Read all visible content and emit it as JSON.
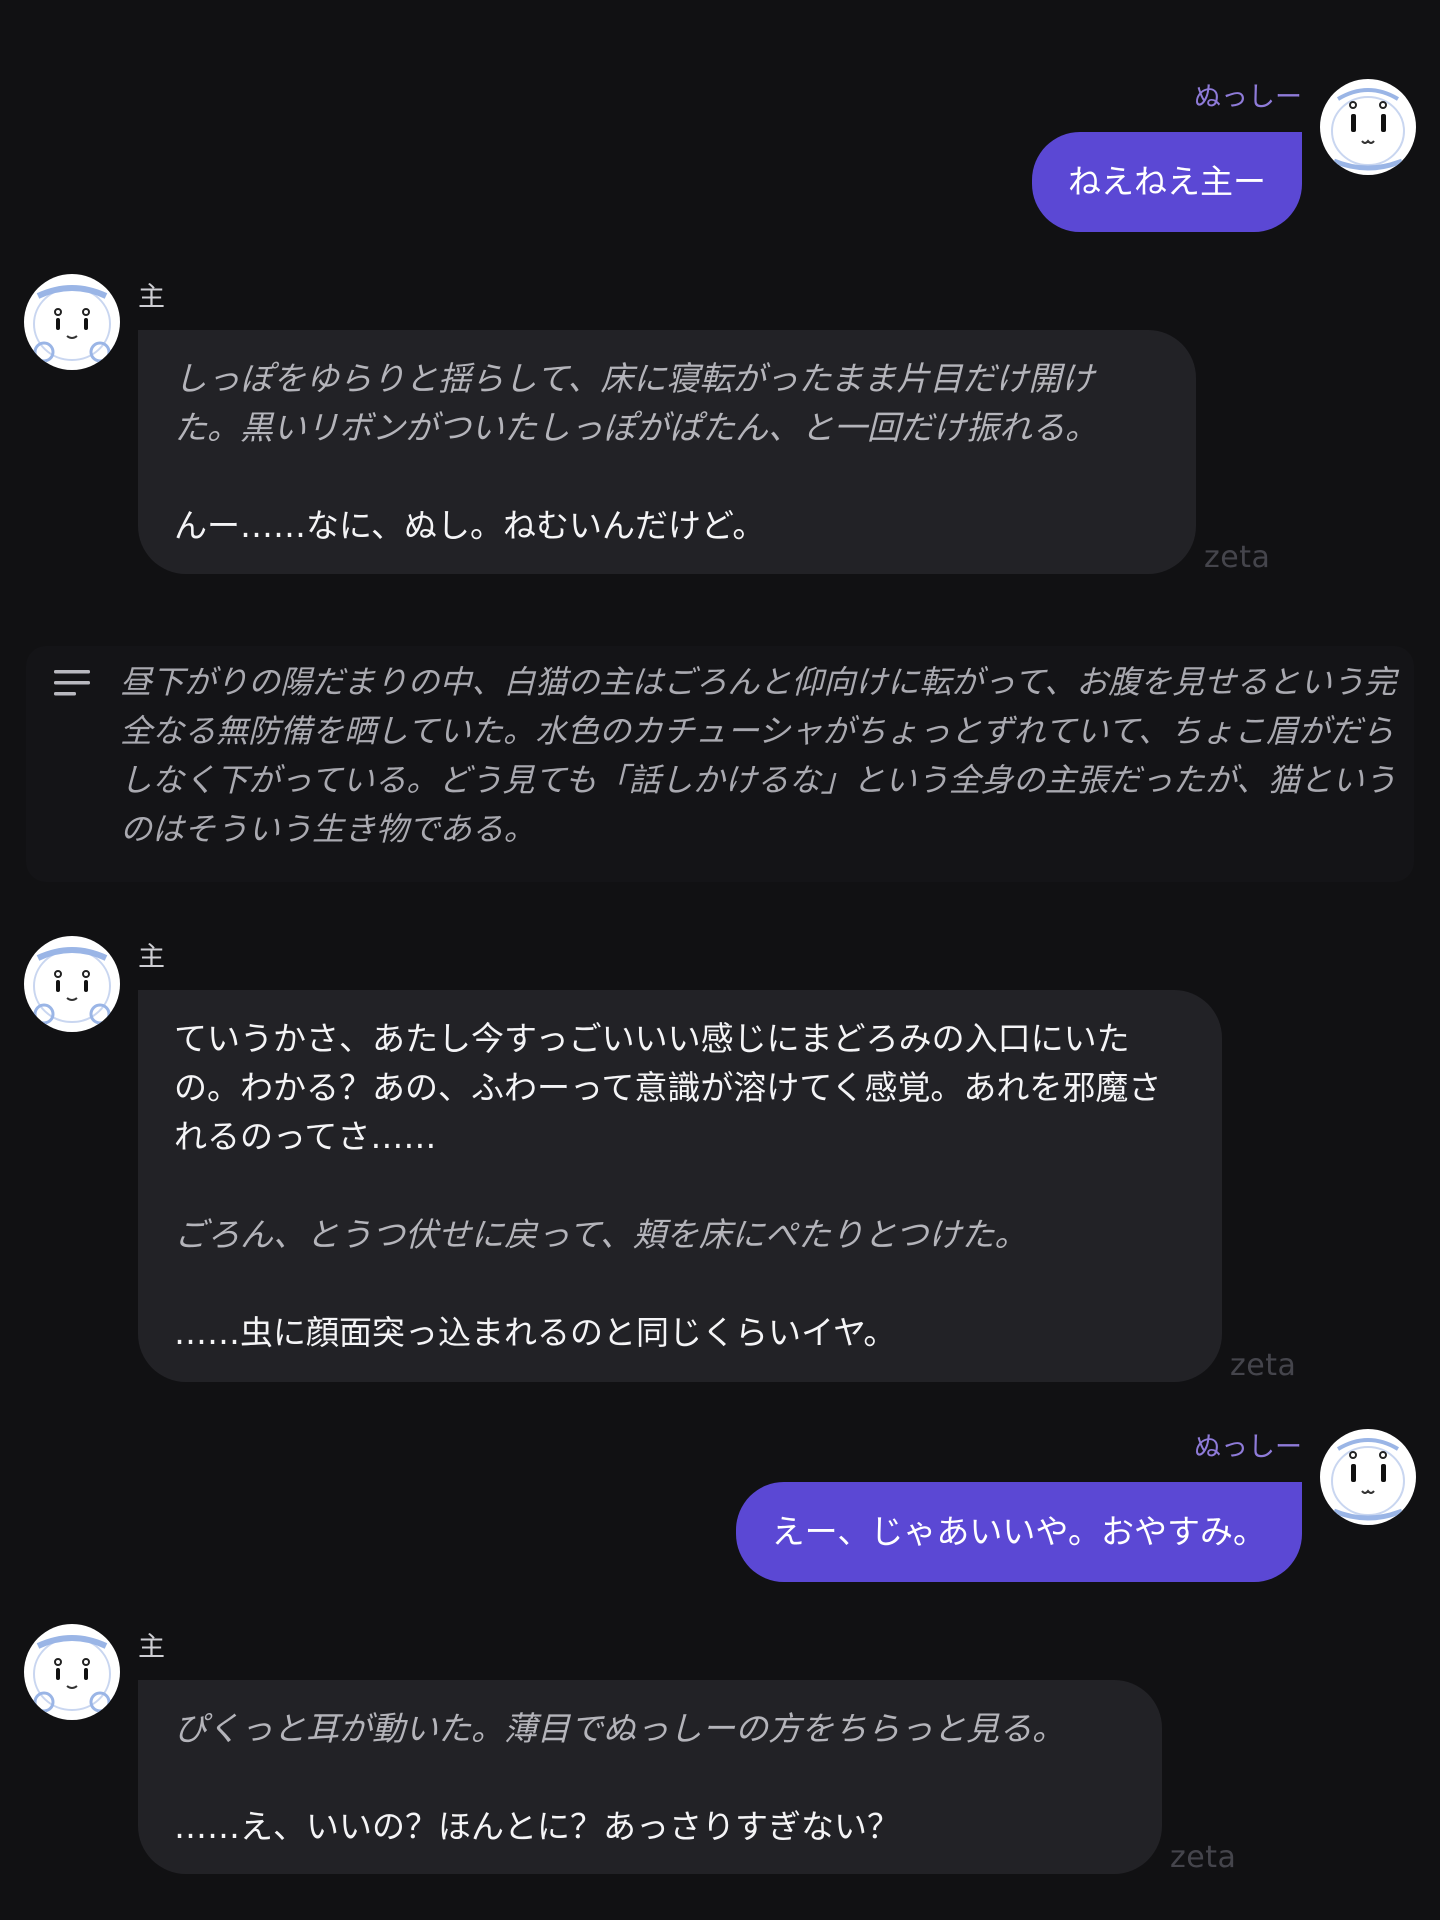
{
  "messages": [
    {
      "role": "user",
      "name": "ぬっしー",
      "text": "ねえねえ主ー"
    },
    {
      "role": "character",
      "name": "主",
      "paragraphs": [
        {
          "style": "action",
          "text": "しっぽをゆらりと揺らして、床に寝転がったまま片目だけ開けた。黒いリボンがついたしっぽがぱたん、と一回だけ振れる。"
        },
        {
          "style": "speech",
          "text": "んー……なに、ぬし。ねむいんだけど。"
        }
      ],
      "badge": "zeta"
    },
    {
      "role": "narration",
      "icon": "narration-lines-icon",
      "text": "昼下がりの陽だまりの中、白猫の主はごろんと仰向けに転がって、お腹を見せるという完全なる無防備を晒していた。水色のカチューシャがちょっとずれていて、ちょこ眉がだらしなく下がっている。どう見ても「話しかけるな」という全身の主張だったが、猫というのはそういう生き物である。"
    },
    {
      "role": "character",
      "name": "主",
      "paragraphs": [
        {
          "style": "speech",
          "text": "ていうかさ、あたし今すっごいいい感じにまどろみの入口にいたの。わかる？あの、ふわーって意識が溶けてく感覚。あれを邪魔されるのってさ……"
        },
        {
          "style": "action",
          "text": "ごろん、とうつ伏せに戻って、頬を床にぺたりとつけた。"
        },
        {
          "style": "speech",
          "text": "……虫に顔面突っ込まれるのと同じくらいイヤ。"
        }
      ],
      "badge": "zeta"
    },
    {
      "role": "user",
      "name": "ぬっしー",
      "text": "えー、じゃあいいや。おやすみ。"
    },
    {
      "role": "character",
      "name": "主",
      "paragraphs": [
        {
          "style": "action",
          "text": "ぴくっと耳が動いた。薄目でぬっしーの方をちらっと見る。"
        },
        {
          "style": "speech",
          "text": "……え、いいの？ほんとに？あっさりすぎない？"
        }
      ],
      "badge": "zeta"
    }
  ],
  "colors": {
    "background": "#111113",
    "user_bubble": "#5b48d4",
    "char_bubble": "#222226",
    "user_name": "#8f7bd9",
    "action_text": "#b4b4ba",
    "badge_text": "#45454c"
  }
}
